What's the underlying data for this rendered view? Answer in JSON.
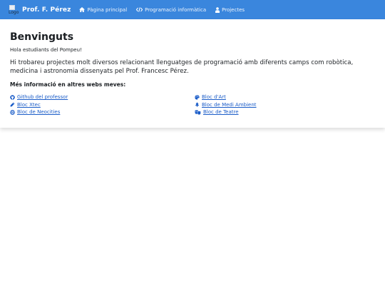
{
  "navbar": {
    "logo_alt": "Logo",
    "brand": "Prof. F. Pérez",
    "links": [
      {
        "label": "Pàgina principal",
        "icon": "home-icon"
      },
      {
        "label": "Programació informàtica",
        "icon": "code-icon"
      },
      {
        "label": "Projectes",
        "icon": "user-icon"
      }
    ]
  },
  "main": {
    "title": "Benvinguts",
    "greeting": "Hola estudiants del Pompeu!",
    "intro": "Hi trobareu projectes molt diversos relacionant llenguatges de programació amb diferents camps com robòtica, medicina i astronomia dissenyats pel Prof. Francesc Pérez.",
    "more_heading": "Més informació en altres webs meves:",
    "links_left": [
      {
        "label": "Github del professor",
        "icon": "github-icon"
      },
      {
        "label": "Bloc Xtec",
        "icon": "pen-icon"
      },
      {
        "label": "Bloc de Neocities",
        "icon": "globe-icon"
      }
    ],
    "links_right": [
      {
        "label": "Bloc d'Art",
        "icon": "palette-icon"
      },
      {
        "label": "Bloc de Medi Ambient",
        "icon": "tree-icon"
      },
      {
        "label": "Bloc de Teatre",
        "icon": "theater-masks-icon"
      }
    ]
  },
  "colors": {
    "navbar": "#3a86dd",
    "link": "#1a5cc8"
  }
}
